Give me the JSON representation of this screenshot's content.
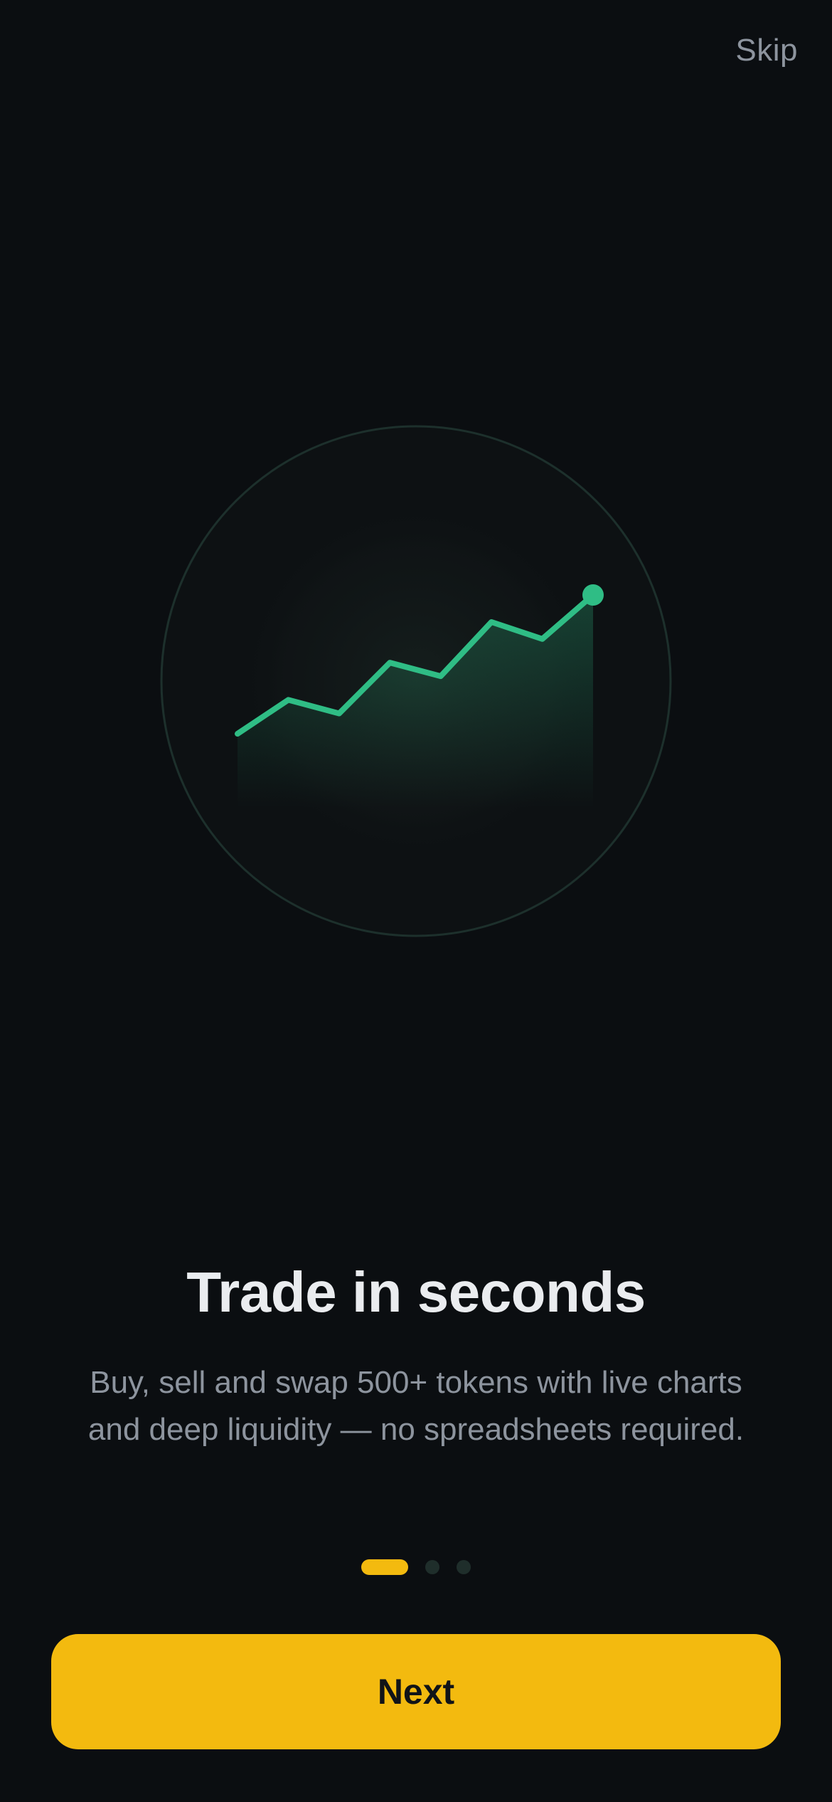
{
  "header": {
    "skip_label": "Skip"
  },
  "hero": {
    "icon": "trend-up-chart-icon",
    "accent_color": "#2fbd85",
    "trend_values": [
      0,
      1.0,
      0.6,
      2.1,
      1.7,
      3.3,
      2.8,
      4.1
    ]
  },
  "onboarding": {
    "title": "Trade in seconds",
    "description": "Buy, sell and swap 500+ tokens with live charts and deep liquidity — no spreadsheets required.",
    "page_count": 3,
    "current_page": 1
  },
  "footer": {
    "next_label": "Next"
  },
  "colors": {
    "background": "#0b0e11",
    "primary": "#f3ba0f",
    "text_primary": "#eaecef",
    "text_secondary": "#8d949e",
    "dot_inactive": "#1f2e2b"
  }
}
